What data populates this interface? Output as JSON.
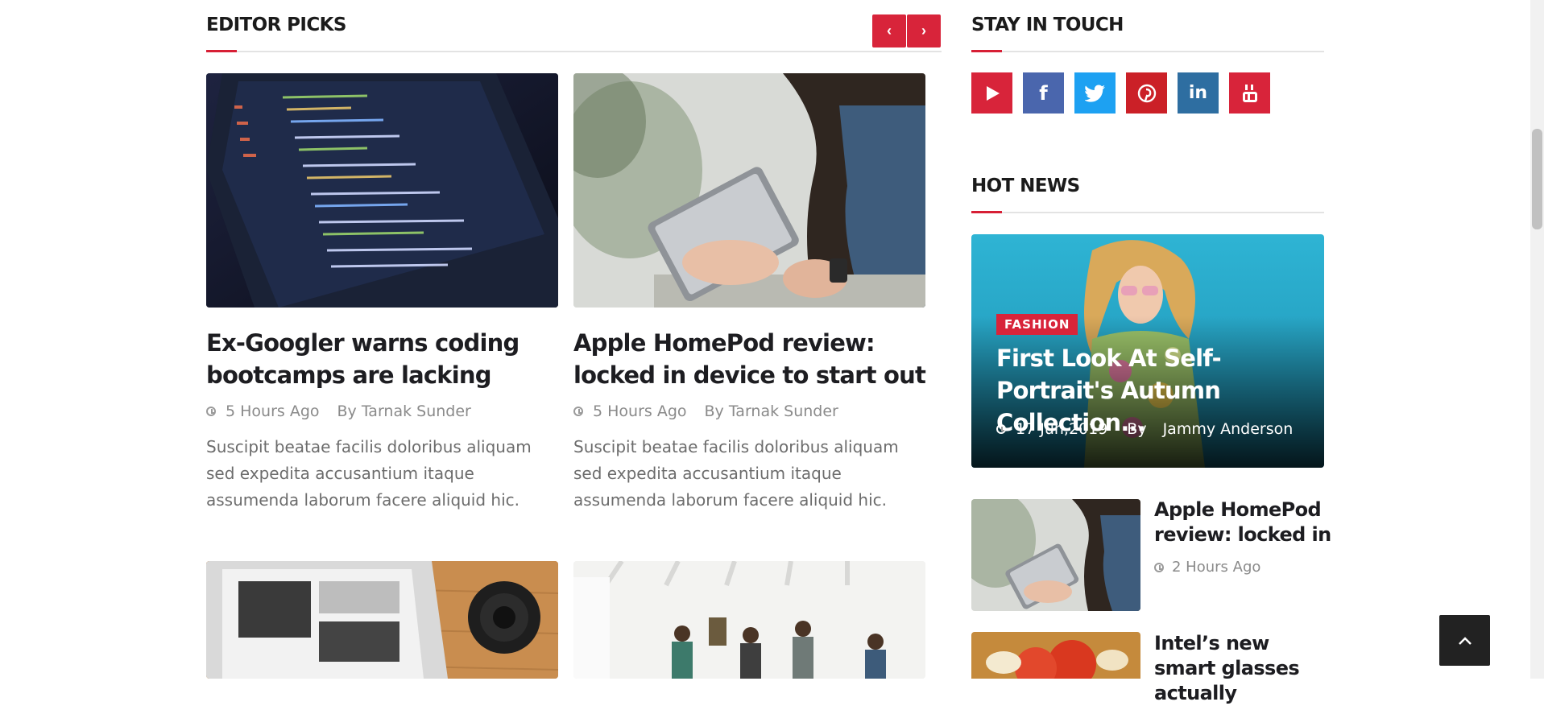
{
  "editor_picks": {
    "title": "EDITOR PICKS",
    "nav": {
      "prev": "‹",
      "next": "›"
    },
    "cards": [
      {
        "title": "Ex-Googler warns coding bootcamps are lacking",
        "time": "5 Hours Ago",
        "author": "By Tarnak Sunder",
        "excerpt": "Suscipit beatae facilis doloribus aliquam sed expedita accusantium itaque assumenda laborum facere aliquid hic."
      },
      {
        "title": "Apple HomePod review: locked in device to start out",
        "time": "5 Hours Ago",
        "author": "By Tarnak Sunder",
        "excerpt": "Suscipit beatae facilis doloribus aliquam sed expedita accusantium itaque assumenda laborum facere aliquid hic."
      }
    ]
  },
  "stay_in_touch": {
    "title": "STAY IN TOUCH",
    "social": [
      {
        "name": "play",
        "color": "#d8243a"
      },
      {
        "name": "facebook",
        "color": "#4a66ad"
      },
      {
        "name": "twitter",
        "color": "#1da1f2"
      },
      {
        "name": "pinterest",
        "color": "#cb2027"
      },
      {
        "name": "linkedin",
        "color": "#2e6ea1"
      },
      {
        "name": "youtube",
        "color": "#d8243a"
      }
    ]
  },
  "hot_news": {
    "title": "HOT NEWS",
    "hero": {
      "badge": "FASHION",
      "title": "First Look At Self-Portrait's Autumn Collection...",
      "date": "17 Jun,2019",
      "by": "By",
      "author": "Jammy Anderson"
    },
    "items": [
      {
        "title": "Apple HomePod review: locked in",
        "time": "2 Hours Ago"
      },
      {
        "title": "Intel’s new smart glasses actually"
      }
    ]
  },
  "colors": {
    "accent": "#d8243a",
    "dark": "#1d1d21",
    "muted": "#8a8a8a"
  }
}
